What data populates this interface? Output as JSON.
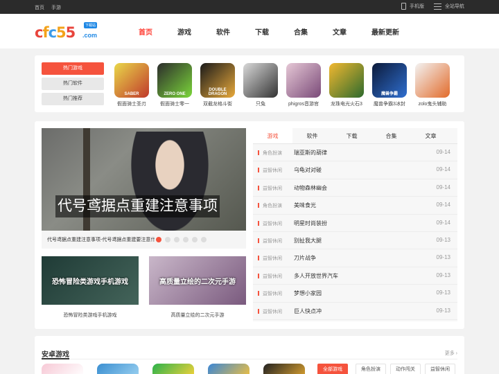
{
  "topbar": {
    "left": [
      "首页",
      "手游"
    ],
    "mobile": "手机版",
    "sitenav": "全站导航"
  },
  "logo": {
    "text": "cfc55",
    "badge": "下载站",
    "domain": ".com"
  },
  "nav": [
    "首页",
    "游戏",
    "软件",
    "下载",
    "合集",
    "文章",
    "最新更新"
  ],
  "hot": {
    "tabs": [
      "热门游戏",
      "热门软件",
      "热门推荐"
    ],
    "games": [
      {
        "name": "假面骑士圣刃",
        "art": "SABER",
        "colors": [
          "#e9d84a",
          "#c0392b"
        ]
      },
      {
        "name": "假面骑士零一",
        "art": "ZERO ONE",
        "colors": [
          "#2c2c2c",
          "#7bd63a"
        ]
      },
      {
        "name": "双截龙格斗街",
        "art": "DOUBLE DRAGON",
        "colors": [
          "#1a1a1a",
          "#e8a93b"
        ]
      },
      {
        "name": "只兔",
        "art": "",
        "colors": [
          "#d9d9d9",
          "#333"
        ]
      },
      {
        "name": "phigros音游官",
        "art": "",
        "colors": [
          "#e6c8d6",
          "#7a4a78"
        ]
      },
      {
        "name": "龙珠电光火石3",
        "art": "",
        "colors": [
          "#f2b830",
          "#2d6a2d"
        ]
      },
      {
        "name": "魔兽争霸3冰封",
        "art": "魔兽争霸",
        "colors": [
          "#0c1a3a",
          "#2f6fd0"
        ]
      },
      {
        "name": "zolo鬼头辅助",
        "art": "",
        "colors": [
          "#f3f3f3",
          "#e26b2b"
        ]
      }
    ]
  },
  "banner": {
    "title": "代号鸢据点重建注意事项",
    "caption": "代号鸢据点重建注意事项-代号鸢据点重建要注意什么",
    "slides": 6
  },
  "subs": [
    {
      "text": "恐怖冒险类游戏手机游戏",
      "caption": "恐怖冒险类游戏手机游戏",
      "colors": [
        "#1f3b36",
        "#44645a"
      ]
    },
    {
      "text": "高质量立绘的二次元手游",
      "caption": "高质量立绘的二次元手游",
      "colors": [
        "#c9b7c9",
        "#7a5a7e"
      ]
    }
  ],
  "news": {
    "tabs": [
      "游戏",
      "软件",
      "下载",
      "合集",
      "文章"
    ],
    "rows": [
      {
        "cat": "角色扮演",
        "title": "瑞亚斯的葫律",
        "date": "09-14"
      },
      {
        "cat": "益智休闲",
        "title": "乌龟对对碰",
        "date": "09-14"
      },
      {
        "cat": "益智休闲",
        "title": "动物森林幽会",
        "date": "09-14"
      },
      {
        "cat": "角色扮演",
        "title": "美味食光",
        "date": "09-14"
      },
      {
        "cat": "益智休闲",
        "title": "明星时尚装扮",
        "date": "09-14"
      },
      {
        "cat": "益智休闲",
        "title": "别扯我大腿",
        "date": "09-13"
      },
      {
        "cat": "益智休闲",
        "title": "刀片战争",
        "date": "09-13"
      },
      {
        "cat": "益智休闲",
        "title": "多人开放世界汽车",
        "date": "09-13"
      },
      {
        "cat": "益智休闲",
        "title": "梦想小家园",
        "date": "09-13"
      },
      {
        "cat": "益智休闲",
        "title": "巨人快点冲",
        "date": "09-13"
      }
    ]
  },
  "android": {
    "title": "安卓游戏",
    "more": "更多",
    "icons": [
      {
        "colors": [
          "#f7c9d6",
          "#ffffff"
        ]
      },
      {
        "colors": [
          "#3b8fd1",
          "#9ad0f0"
        ]
      },
      {
        "colors": [
          "#2bb24c",
          "#f4d23a"
        ]
      },
      {
        "colors": [
          "#3a86d6",
          "#f0c040"
        ]
      },
      {
        "colors": [
          "#222222",
          "#d8a030"
        ]
      }
    ],
    "tags": [
      "全部游戏",
      "角色扮演",
      "动作闯关",
      "益智休闲"
    ]
  },
  "colors": {
    "accent": "#f5533d",
    "nav_active": "#ff3b30",
    "topbar": "#2b2b2b"
  }
}
